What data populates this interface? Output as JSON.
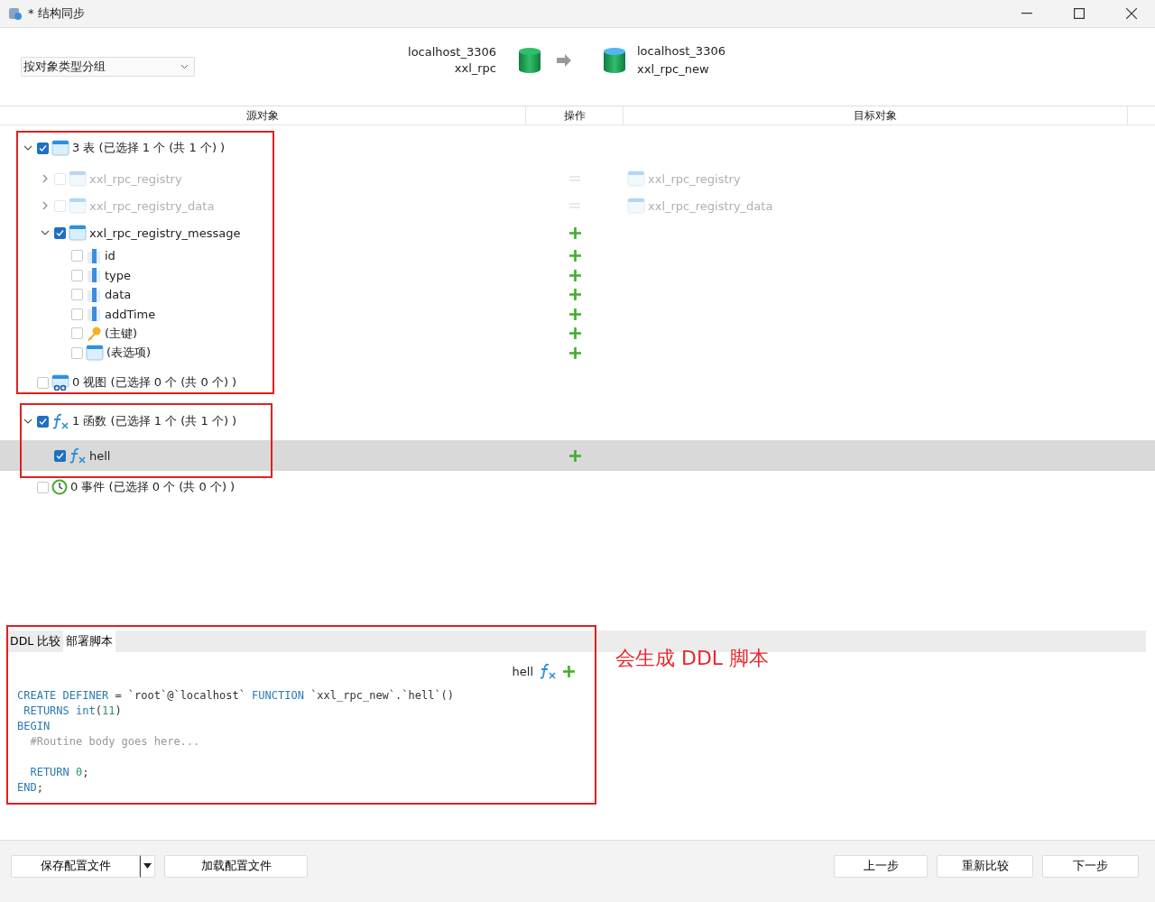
{
  "window": {
    "title": "* 结构同步"
  },
  "group_by": {
    "value": "按对象类型分组"
  },
  "source": {
    "server": "localhost_3306",
    "database": "xxl_rpc"
  },
  "target": {
    "server": "localhost_3306",
    "database": "xxl_rpc_new"
  },
  "columns": [
    "源对象",
    "操作",
    "目标对象"
  ],
  "tree": [
    {
      "kind": "table-group",
      "label": "3 表 (已选择 1 个 (共 1 个) )",
      "checked": true,
      "expanded": true,
      "disabled": false,
      "selected": false,
      "children": [
        {
          "kind": "table",
          "label": "xxl_rpc_registry",
          "checked": false,
          "expanded": false,
          "disabled": true,
          "selected": false,
          "action": {
            "kind": "equal"
          },
          "target": "xxl_rpc_registry"
        },
        {
          "kind": "table",
          "label": "xxl_rpc_registry_data",
          "checked": false,
          "expanded": false,
          "disabled": true,
          "selected": false,
          "action": {
            "kind": "equal"
          },
          "target": "xxl_rpc_registry_data"
        },
        {
          "kind": "table",
          "label": "xxl_rpc_registry_message",
          "checked": true,
          "expanded": true,
          "disabled": false,
          "selected": false,
          "action": {
            "kind": "add"
          },
          "children": [
            {
              "kind": "column",
              "label": "id",
              "checked": false,
              "disabled": false,
              "selected": false,
              "action": {
                "kind": "add"
              }
            },
            {
              "kind": "column",
              "label": "type",
              "checked": false,
              "disabled": false,
              "selected": false,
              "action": {
                "kind": "add"
              }
            },
            {
              "kind": "column",
              "label": "data",
              "checked": false,
              "disabled": false,
              "selected": false,
              "action": {
                "kind": "add"
              }
            },
            {
              "kind": "column",
              "label": "addTime",
              "checked": false,
              "disabled": false,
              "selected": false,
              "action": {
                "kind": "add"
              }
            },
            {
              "kind": "key",
              "label": "(主键)",
              "checked": false,
              "disabled": false,
              "selected": false,
              "action": {
                "kind": "add"
              }
            },
            {
              "kind": "options",
              "label": "(表选项)",
              "checked": false,
              "disabled": false,
              "selected": false,
              "action": {
                "kind": "add"
              }
            }
          ]
        }
      ]
    },
    {
      "kind": "view-group",
      "label": "0 视图 (已选择 0 个 (共 0 个) )",
      "checked": false,
      "disabled": false,
      "selected": false
    },
    {
      "kind": "function-group",
      "label": "1 函数 (已选择 1 个 (共 1 个) )",
      "checked": true,
      "expanded": true,
      "disabled": false,
      "selected": false,
      "children": [
        {
          "kind": "function",
          "label": "hell",
          "checked": true,
          "disabled": false,
          "selected": true,
          "action": {
            "kind": "add"
          }
        }
      ]
    },
    {
      "kind": "event-group",
      "label": "0 事件 (已选择 0 个 (共 0 个) )",
      "checked": false,
      "disabled": false,
      "selected": false
    }
  ],
  "bottom_panel": {
    "tabs": [
      {
        "label": "DDL 比较",
        "selected": false
      },
      {
        "label": "部署脚本",
        "selected": true
      }
    ],
    "object": {
      "name": "hell",
      "action": {
        "kind": "add"
      }
    },
    "code_lines": [
      {
        "kind": "code",
        "tokens": [
          {
            "kind": "keyword",
            "text": "CREATE DEFINER"
          },
          {
            "kind": "plain",
            "text": " = `root`@`localhost` "
          },
          {
            "kind": "keyword",
            "text": "FUNCTION"
          },
          {
            "kind": "plain",
            "text": " `xxl_rpc_new`.`hell`()"
          }
        ]
      },
      {
        "kind": "code",
        "tokens": [
          {
            "kind": "keyword",
            "text": " RETURNS int"
          },
          {
            "kind": "plain",
            "text": "("
          },
          {
            "kind": "number",
            "text": "11"
          },
          {
            "kind": "plain",
            "text": ")"
          }
        ]
      },
      {
        "kind": "code",
        "tokens": [
          {
            "kind": "keyword",
            "text": "BEGIN"
          }
        ]
      },
      {
        "kind": "code",
        "tokens": [
          {
            "kind": "comment",
            "text": "  #Routine body goes here..."
          }
        ]
      },
      {
        "kind": "blank"
      },
      {
        "kind": "code",
        "tokens": [
          {
            "kind": "keyword",
            "text": "  RETURN "
          },
          {
            "kind": "number",
            "text": "0"
          },
          {
            "kind": "plain",
            "text": ";"
          }
        ]
      },
      {
        "kind": "code",
        "tokens": [
          {
            "kind": "keyword",
            "text": "END"
          },
          {
            "kind": "plain",
            "text": ";"
          }
        ]
      }
    ]
  },
  "annotation": {
    "note": "会生成 DDL 脚本"
  },
  "buttons_left": [
    "保存配置文件",
    "加载配置文件"
  ],
  "buttons_right": [
    "上一步",
    "重新比较",
    "下一步"
  ]
}
